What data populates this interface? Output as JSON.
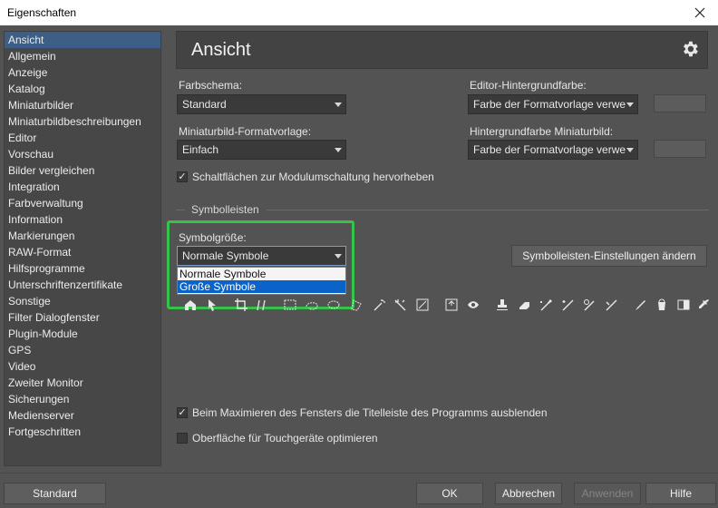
{
  "window": {
    "title": "Eigenschaften"
  },
  "sidebar": {
    "items": [
      {
        "label": "Ansicht",
        "selected": true
      },
      {
        "label": "Allgemein"
      },
      {
        "label": "Anzeige"
      },
      {
        "label": "Katalog"
      },
      {
        "label": "Miniaturbilder"
      },
      {
        "label": "Miniaturbildbeschreibungen"
      },
      {
        "label": "Editor"
      },
      {
        "label": "Vorschau"
      },
      {
        "label": "Bilder vergleichen"
      },
      {
        "label": "Integration"
      },
      {
        "label": "Farbverwaltung"
      },
      {
        "label": "Information"
      },
      {
        "label": "Markierungen"
      },
      {
        "label": "RAW-Format"
      },
      {
        "label": "Hilfsprogramme"
      },
      {
        "label": "Unterschriftenzertifikate"
      },
      {
        "label": "Sonstige"
      },
      {
        "label": "Filter Dialogfenster"
      },
      {
        "label": "Plugin-Module"
      },
      {
        "label": "GPS"
      },
      {
        "label": "Video"
      },
      {
        "label": "Zweiter Monitor"
      },
      {
        "label": "Sicherungen"
      },
      {
        "label": "Medienserver"
      },
      {
        "label": "Fortgeschritten"
      }
    ]
  },
  "main": {
    "title": "Ansicht",
    "farbschema": {
      "label": "Farbschema:",
      "value": "Standard"
    },
    "editor_bg": {
      "label": "Editor-Hintergrundfarbe:",
      "value": "Farbe der Formatvorlage verwe"
    },
    "miniatur_vorlage": {
      "label": "Miniaturbild-Formatvorlage:",
      "value": "Einfach"
    },
    "miniatur_bg": {
      "label": "Hintergrundfarbe Miniaturbild:",
      "value": "Farbe der Formatvorlage verwe"
    },
    "highlight_checkbox": {
      "label": "Schaltflächen zur Modulumschaltung hervorheben",
      "checked": true
    },
    "symbolleisten_section": "Symbolleisten",
    "symbolgroesse": {
      "label": "Symbolgröße:",
      "value": "Normale Symbole",
      "options": [
        "Normale Symbole",
        "Große Symbole"
      ],
      "highlighted_option": "Große Symbole"
    },
    "toolbar_settings_button": "Symbolleisten-Einstellungen ändern",
    "toolbar_icons": [
      "home-icon",
      "pointer-icon",
      "crop-icon",
      "straighten-icon",
      "rect-select-icon",
      "lasso-icon",
      "ellipse-select-icon",
      "polygon-lasso-icon",
      "magic-wand-icon",
      "sparkle-wand-icon",
      "transform-icon",
      "info-icon",
      "eye-icon",
      "stamp-icon",
      "eraser-icon",
      "heal-brush-icon",
      "spot-heal-icon",
      "clone-brush-icon",
      "retouch-brush-icon",
      "paint-brush-icon",
      "bucket-icon",
      "gradient-icon",
      "dropper-icon"
    ],
    "maximize_checkbox": {
      "label": "Beim Maximieren des Fensters die Titelleiste des Programms ausblenden",
      "checked": true
    },
    "touch_checkbox": {
      "label": "Oberfläche für Touchgeräte optimieren",
      "checked": false
    }
  },
  "footer": {
    "standard": "Standard",
    "ok": "OK",
    "abbrechen": "Abbrechen",
    "anwenden": "Anwenden",
    "hilfe": "Hilfe"
  },
  "colors": {
    "selection": "#3d5e87",
    "dropdown_highlight": "#0a63c9",
    "callout": "#35c34a"
  }
}
